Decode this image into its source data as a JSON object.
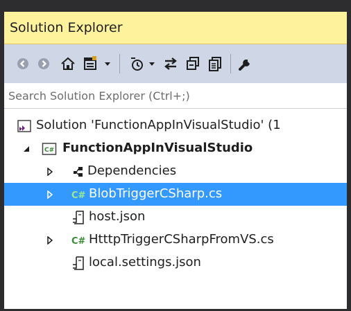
{
  "panel": {
    "title": "Solution Explorer"
  },
  "toolbar": {
    "buttons": [
      {
        "name": "back-icon"
      },
      {
        "name": "forward-icon"
      },
      {
        "name": "home-icon"
      },
      {
        "name": "switch-views-icon"
      },
      {
        "name": "dropdown-icon"
      },
      {
        "name": "pending-changes-filter-icon"
      },
      {
        "name": "dropdown-icon"
      },
      {
        "name": "sync-with-active-document-icon"
      },
      {
        "name": "collapse-all-icon"
      },
      {
        "name": "show-all-files-icon"
      },
      {
        "name": "properties-wrench-icon"
      }
    ]
  },
  "search": {
    "placeholder": "Search Solution Explorer (Ctrl+;)"
  },
  "tree": {
    "solution_label": "Solution 'FunctionAppInVisualStudio' (1",
    "project_label": "FunctionAppInVisualStudio",
    "items": [
      {
        "label": "Dependencies",
        "icon": "dependencies-icon",
        "expandable": true
      },
      {
        "label": "BlobTriggerCSharp.cs",
        "icon": "csharp-file-icon",
        "expandable": true,
        "selected": true
      },
      {
        "label": "host.json",
        "icon": "json-file-icon",
        "expandable": false
      },
      {
        "label": "HtttpTriggerCSharpFromVS.cs",
        "icon": "csharp-file-icon",
        "expandable": true
      },
      {
        "label": "local.settings.json",
        "icon": "json-file-icon",
        "expandable": false
      }
    ]
  },
  "colors": {
    "title_bar_bg": "#fff29d",
    "toolbar_bg": "#cfd6e5",
    "selection_bg": "#3399ff",
    "csharp_green": "#388a34"
  }
}
